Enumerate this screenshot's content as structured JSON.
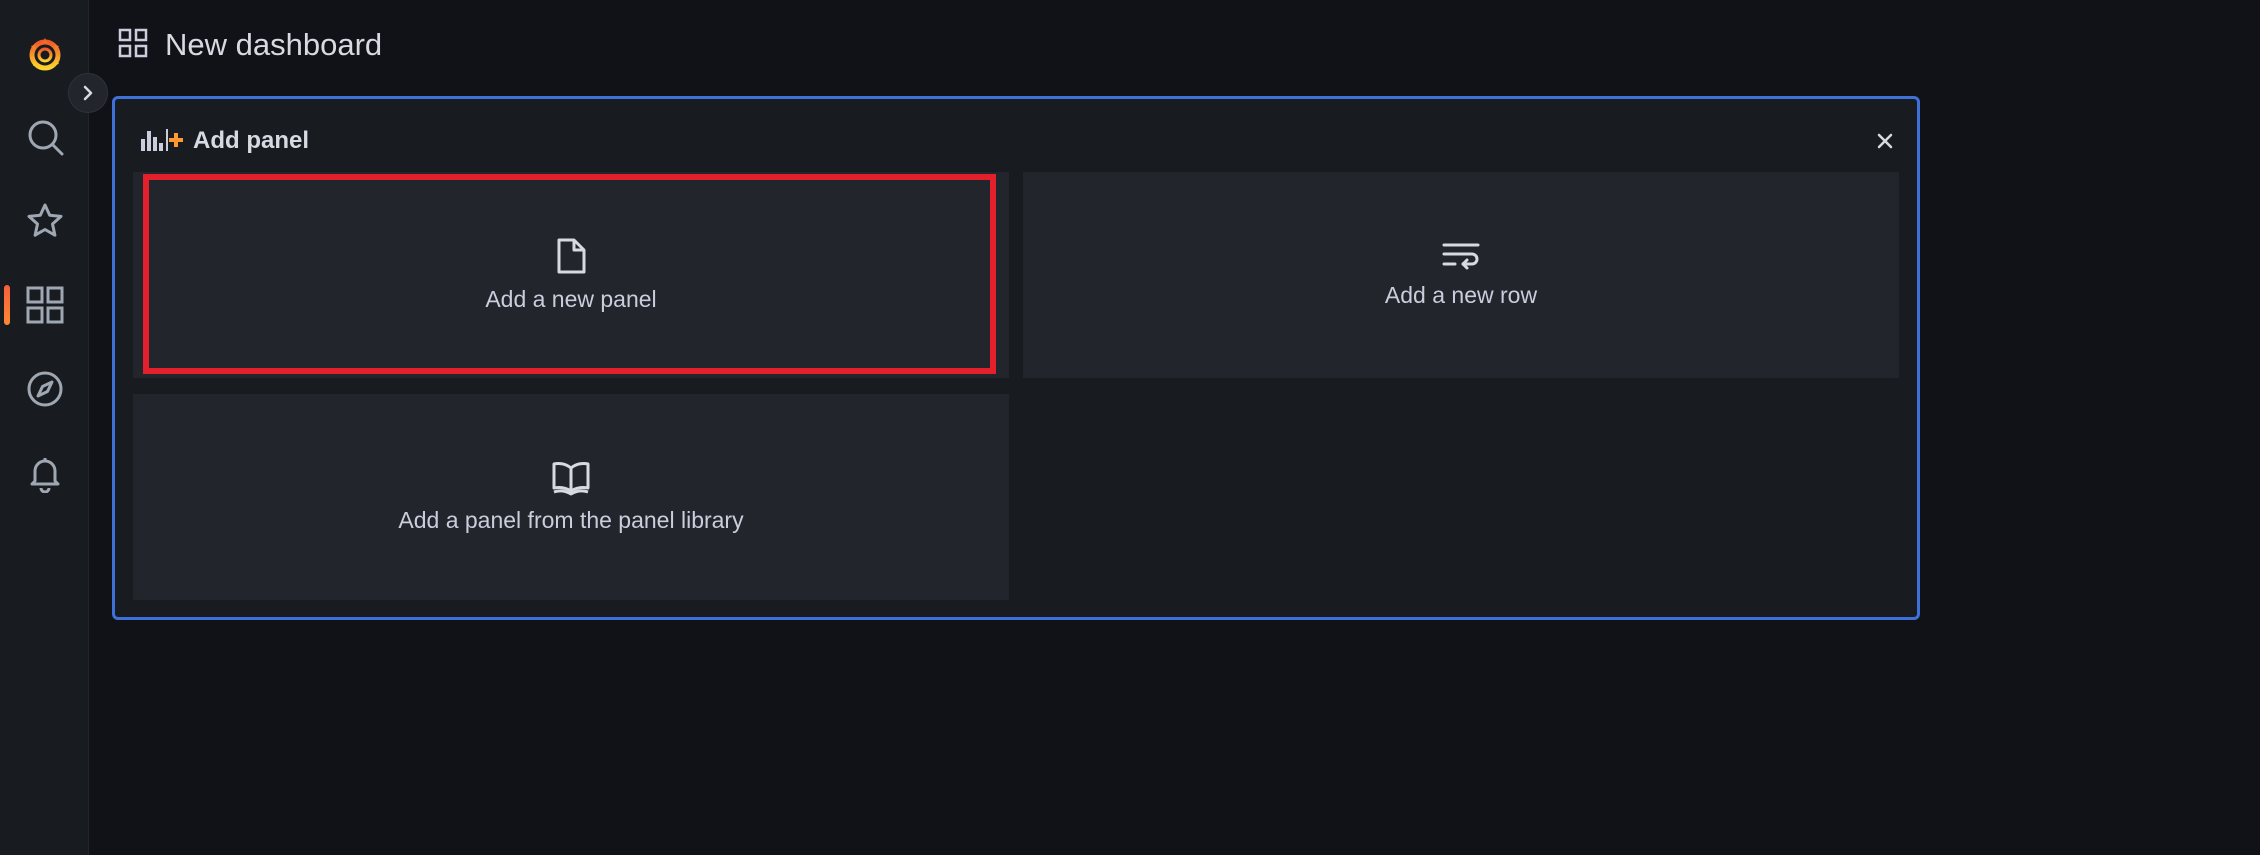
{
  "header": {
    "title": "New dashboard"
  },
  "sidebar": {
    "items": [
      {
        "icon": "grafana-logo-icon"
      },
      {
        "icon": "search-icon"
      },
      {
        "icon": "star-icon"
      },
      {
        "icon": "dashboards-icon",
        "active": true
      },
      {
        "icon": "explore-compass-icon"
      },
      {
        "icon": "alerting-bell-icon"
      }
    ]
  },
  "add_panel": {
    "title": "Add panel",
    "options": {
      "new_panel": "Add a new panel",
      "new_row": "Add a new row",
      "library_panel": "Add a panel from the panel library"
    }
  },
  "colors": {
    "accent_border": "#3d71d9",
    "highlight": "#e4202c",
    "brand": "#f55f3e"
  }
}
